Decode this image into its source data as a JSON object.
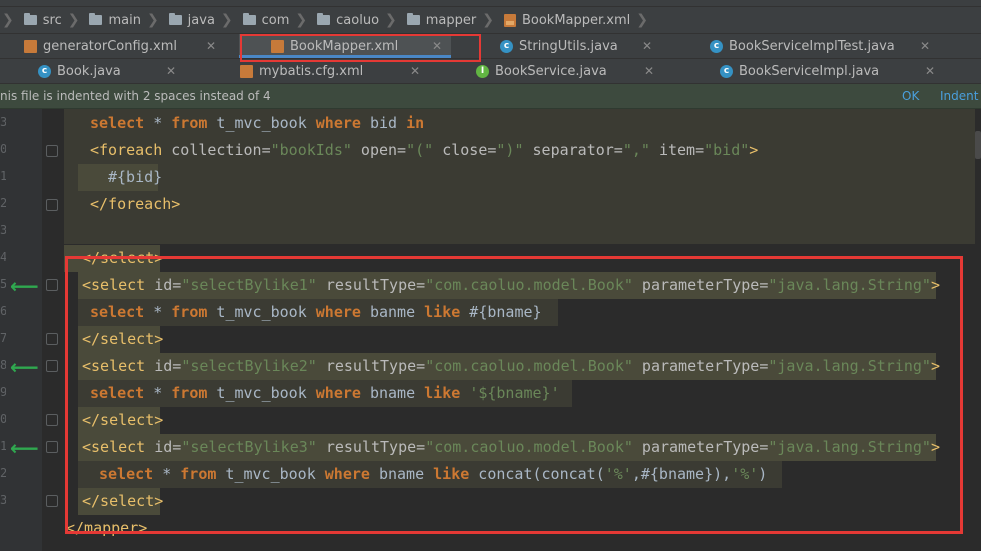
{
  "breadcrumb": [
    {
      "label": "src",
      "icon": "folder-icon"
    },
    {
      "label": "main",
      "icon": "folder-icon"
    },
    {
      "label": "java",
      "icon": "folder-icon"
    },
    {
      "label": "com",
      "icon": "folder-icon"
    },
    {
      "label": "caoluo",
      "icon": "folder-icon"
    },
    {
      "label": "mapper",
      "icon": "folder-icon"
    },
    {
      "label": "BookMapper.xml",
      "icon": "xml-file-icon"
    }
  ],
  "tabs_row1": [
    {
      "label": "generatorConfig.xml",
      "icon": "xml-file-icon"
    },
    {
      "label": "BookMapper.xml",
      "icon": "xml-file-icon",
      "active": true
    },
    {
      "label": "StringUtils.java",
      "icon": "class-icon"
    },
    {
      "label": "BookServiceImplTest.java",
      "icon": "class-icon"
    }
  ],
  "tabs_row2": [
    {
      "label": "Book.java",
      "icon": "class-icon"
    },
    {
      "label": "mybatis.cfg.xml",
      "icon": "xml-file-icon"
    },
    {
      "label": "BookService.java",
      "icon": "interface-icon"
    },
    {
      "label": "BookServiceImpl.java",
      "icon": "class-icon"
    }
  ],
  "notification": {
    "message": "nis file is indented with 2 spaces instead of 4",
    "ok": "OK",
    "indent": "Indent"
  },
  "gutter_numbers": [
    "3",
    "0",
    "1",
    "2",
    "3",
    "4",
    "5",
    "6",
    "7",
    "8",
    "9",
    "0",
    "1",
    "2",
    "3"
  ],
  "code": {
    "l1": {
      "select": "select",
      "star": " * ",
      "from": "from",
      "table": " t_mvc_book ",
      "where": "where",
      "field": " bid ",
      "in": "in"
    },
    "l2": {
      "open": "<foreach",
      "a1": " collection=",
      "v1": "\"bookIds\"",
      "a2": " open=",
      "v2": "\"(\"",
      "a3": " close=",
      "v3": "\")\"",
      "a4": " separator=",
      "v4": "\",\"",
      "a5": " item=",
      "v5": "\"bid\"",
      "close": ">"
    },
    "l3": {
      "text": "#{bid}"
    },
    "l4": {
      "text": "</foreach>"
    },
    "l5": {
      "text": "</select>"
    },
    "s1": {
      "open": "<select",
      "a1": " id=",
      "v1": "\"selectBylike1\"",
      "a2": " resultType=",
      "v2": "\"com.caoluo.model.Book\"",
      "a3": " parameterType=",
      "v3": "\"java.lang.String\"",
      "close": ">"
    },
    "s1b": {
      "select": "select",
      "star": " * ",
      "from": "from",
      "table": " t_mvc_book ",
      "where": "where",
      "field": " banme ",
      "like": "like",
      "rest": " #{bname}"
    },
    "s1c": {
      "text": "</select>"
    },
    "s2": {
      "open": "<select",
      "a1": " id=",
      "v1": "\"selectBylike2\"",
      "a2": " resultType=",
      "v2": "\"com.caoluo.model.Book\"",
      "a3": " parameterType=",
      "v3": "\"java.lang.String\"",
      "close": ">"
    },
    "s2b": {
      "select": "select",
      "star": " * ",
      "from": "from",
      "table": " t_mvc_book ",
      "where": "where",
      "field": " bname ",
      "like": "like",
      "rest": " ",
      "strv": "'${bname}'"
    },
    "s2c": {
      "text": "</select>"
    },
    "s3": {
      "open": "<select",
      "a1": " id=",
      "v1": "\"selectBylike3\"",
      "a2": " resultType=",
      "v2": "\"com.caoluo.model.Book\"",
      "a3": " parameterType=",
      "v3": "\"java.lang.String\"",
      "close": ">"
    },
    "s3b": {
      "select": "select",
      "star": " * ",
      "from": "from",
      "table": " t_mvc_book ",
      "where": "where",
      "field": " bname ",
      "like": "like",
      "rest1": " concat(concat(",
      "q1": "'%'",
      "rest2": ",#{bname}),",
      "q2": "'%'",
      "rest3": ")"
    },
    "s3c": {
      "text": "</select>"
    },
    "end": {
      "text": "</mapper>"
    }
  },
  "colors": {
    "accent": "#4a88c7",
    "highlight": "#e53935",
    "arrow": "#2fa84f"
  }
}
